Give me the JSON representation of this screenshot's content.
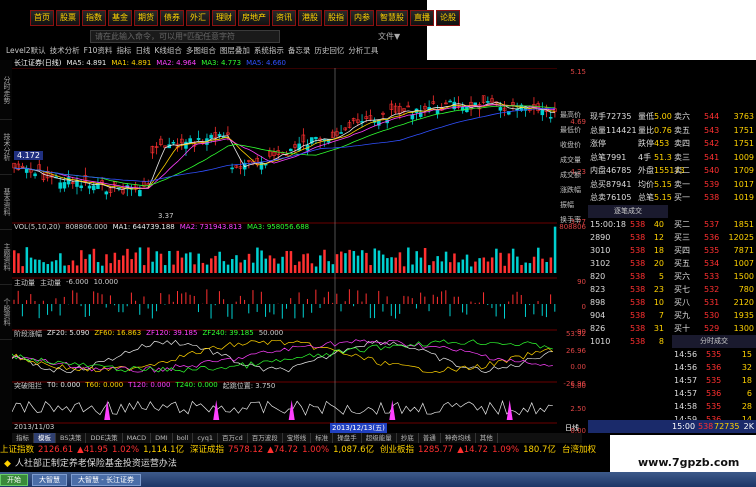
{
  "menu": [
    "首页",
    "股票",
    "指数",
    "基金",
    "期货",
    "债券",
    "外汇",
    "理财",
    "房地产",
    "资讯",
    "港股",
    "股指",
    "内参",
    "智慧股",
    "直播",
    "论股"
  ],
  "search": {
    "placeholder": "请在此输入命令，可以用*匹配任意字符"
  },
  "file_menu": "文件▼",
  "toolbar": [
    "Level2默认",
    "技术分析",
    "F10资料",
    "指标",
    "日线",
    "K线组合",
    "多图组合",
    "图层叠加",
    "系统指示",
    "备忘录",
    "历史回忆",
    "分析工具"
  ],
  "chart_title": {
    "name": "长江证券(日线)",
    "ma": [
      "MA5: 4.891",
      "MA1: 4.891",
      "MA2: 4.964",
      "MA3: 4.773",
      "MA5: 4.660"
    ]
  },
  "left_tabs": [
    "分时走势",
    "技术分析",
    "基本资料",
    "主题资料",
    "个股资料"
  ],
  "price_label": "4.172",
  "low_label": "3.37",
  "vol_pane": {
    "title": "VOL(5,10,20)",
    "v": "808806.000",
    "ma1": "MA1: 644739.188",
    "ma2": "MA2: 731943.813",
    "ma3": "MA3: 958056.688"
  },
  "main_force": {
    "title": "主动量",
    "label": "主动量",
    "v1": "-6.000",
    "v2": "10.000"
  },
  "trend_pane": {
    "title": "阶段涨幅",
    "zf20": "ZF20: 5.090",
    "zf60": "ZF60: 16.863",
    "zf120": "ZF120: 39.185",
    "zf240": "ZF240: 39.185",
    "v": "50.000"
  },
  "break_pane": {
    "title": "突破阻拦",
    "t0": "T0: 0.000",
    "t60": "T60: 0.000",
    "t120": "T120: 0.000",
    "t240": "T240: 0.000",
    "sig": "起跳位置: 3.750"
  },
  "date_label": "2013/12/13(五)",
  "start_date": "2013/11/03",
  "day_tab": "日线",
  "axis": {
    "main": [
      "5.15",
      "4.69",
      "4.23",
      "3.77"
    ],
    "vol": [
      "808806"
    ],
    "mf": [
      "90",
      "0",
      "-90"
    ],
    "trend": [
      "53.92",
      "26.96",
      "0.00",
      "-26.96"
    ],
    "break": [
      "5.00",
      "2.50",
      "0.00"
    ]
  },
  "stats": [
    "最高价",
    "最低价",
    "收盘价",
    "成交量",
    "成交额",
    "涨跌幅",
    "振幅",
    "换手率"
  ],
  "quote": {
    "rows": [
      {
        "l": "现手72735",
        "v": "量低",
        "n": "5.00",
        "side": "卖六",
        "p": "544",
        "q": "3763"
      },
      {
        "l": "总量114421",
        "v": "量比",
        "n": "0.76",
        "side": "卖五",
        "p": "543",
        "q": "1751"
      },
      {
        "l": "涨停",
        "v": "跌停",
        "n": "453",
        "side": "卖四",
        "p": "542",
        "q": "1751"
      },
      {
        "l": "总笔7991",
        "v": "4手",
        "n": "51.3",
        "side": "卖三",
        "p": "541",
        "q": "1009"
      },
      {
        "l": "内盘46785",
        "v": "外盘",
        "n": "155173",
        "side": "卖二",
        "p": "540",
        "q": "1709"
      },
      {
        "l": "总买87941",
        "v": "均价",
        "n": "5.15",
        "side": "卖一",
        "p": "539",
        "q": "1017"
      },
      {
        "l": "总卖76105",
        "v": "总笔",
        "n": "5.15",
        "side": "买一",
        "p": "538",
        "q": "1019"
      }
    ],
    "buy": [
      {
        "side": "买二",
        "p": "537",
        "q": "1851"
      },
      {
        "side": "买三",
        "p": "536",
        "q": "12025"
      },
      {
        "side": "买四",
        "p": "535",
        "q": "7871"
      },
      {
        "side": "买五",
        "p": "534",
        "q": "1007"
      },
      {
        "side": "买六",
        "p": "533",
        "q": "1500"
      },
      {
        "side": "买七",
        "p": "532",
        "q": "780"
      },
      {
        "side": "买八",
        "p": "531",
        "q": "2120"
      },
      {
        "side": "买九",
        "p": "530",
        "q": "1935"
      },
      {
        "side": "买十",
        "p": "529",
        "q": "1300"
      }
    ],
    "tick_header": "逐笔成交",
    "tick_header2": "分时成交",
    "ticks": [
      {
        "t": "15:00:18",
        "p": "538",
        "v": "40"
      },
      {
        "t": "2890",
        "p": "538",
        "v": "12"
      },
      {
        "t": "3010",
        "p": "538",
        "v": "18"
      },
      {
        "t": "3102",
        "p": "538",
        "v": "20"
      },
      {
        "t": "820",
        "p": "538",
        "v": "5"
      },
      {
        "t": "823",
        "p": "538",
        "v": "23"
      },
      {
        "t": "898",
        "p": "538",
        "v": "10"
      },
      {
        "t": "904",
        "p": "538",
        "v": "7"
      },
      {
        "t": "826",
        "p": "538",
        "v": "31"
      },
      {
        "t": "1010",
        "p": "538",
        "v": "8"
      }
    ],
    "ticks2": [
      {
        "t": "14:56",
        "p": "535",
        "v": "15"
      },
      {
        "t": "14:56",
        "p": "536",
        "v": "32"
      },
      {
        "t": "14:57",
        "p": "535",
        "v": "18"
      },
      {
        "t": "14:57",
        "p": "536",
        "v": "6"
      },
      {
        "t": "14:58",
        "p": "535",
        "v": "28"
      },
      {
        "t": "14:59",
        "p": "536",
        "v": "14"
      }
    ],
    "last": {
      "t": "15:00",
      "p": "538",
      "v": "72735",
      "flag": "2K"
    }
  },
  "bottom_tabs": [
    "指标",
    "模板",
    "BS决策",
    "DDE决策",
    "MACD",
    "DMI",
    "boll",
    "cyq1",
    "百万cd",
    "百万波段",
    "宝塔线",
    "标准",
    "操盘手",
    "超级能量",
    "抄底",
    "普通",
    "神奇均线",
    "其他"
  ],
  "index_bar": [
    {
      "name": "上证指数",
      "v": "2126.61",
      "c": "▲41.95",
      "pct": "1.02%",
      "amt": "1,114.1亿"
    },
    {
      "name": "深证成指",
      "v": "7578.12",
      "c": "▲74.72",
      "pct": "1.00%",
      "amt": "1,087.6亿"
    },
    {
      "name": "创业板指",
      "v": "1285.77",
      "c": "▲14.72",
      "pct": "1.09%",
      "amt": "180.7亿"
    },
    {
      "name": "台湾加权",
      "v": "",
      "c": "",
      "pct": "",
      "amt": ""
    }
  ],
  "news": "人社部正制定养老保险基金投资运营办法",
  "taskbar": [
    "开始",
    "大智慧",
    "大智慧 - 长江证券"
  ],
  "watermark": "www.7gpzb.com",
  "colors": {
    "up": "#ff3030",
    "down": "#00d0d0",
    "yellow": "#ffd200",
    "ma_white": "#e8e8e8",
    "ma_blue": "#3050ff",
    "ma_pink": "#ff40ff",
    "green": "#30ff30"
  }
}
